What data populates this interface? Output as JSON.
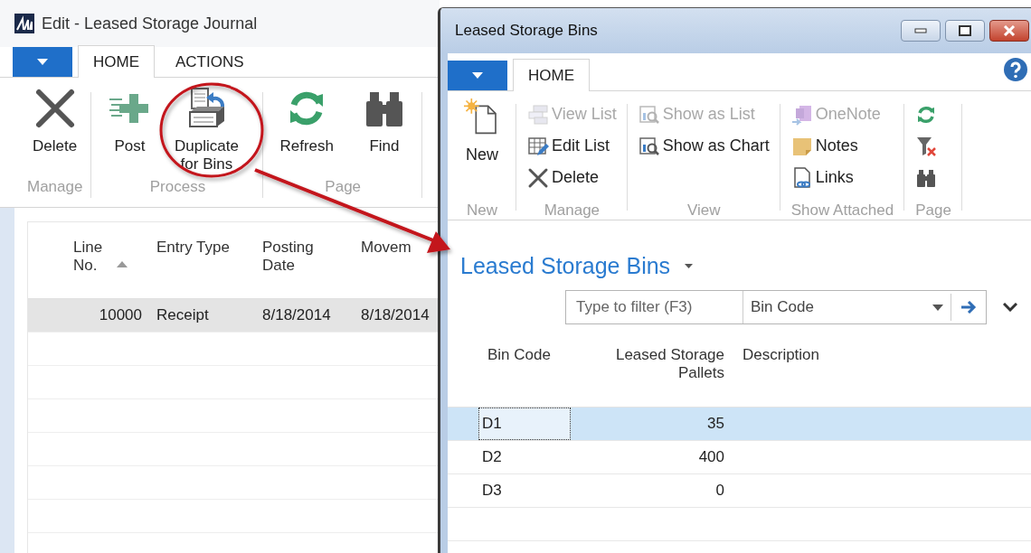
{
  "journal_window": {
    "title": "Edit - Leased Storage Journal",
    "tabs": [
      {
        "label": "HOME",
        "selected": true
      },
      {
        "label": "ACTIONS",
        "selected": false
      }
    ],
    "ribbon_groups": [
      {
        "label": "Manage",
        "actions": [
          {
            "kind": "delete",
            "label": "Delete"
          }
        ]
      },
      {
        "label": "Process",
        "actions": [
          {
            "kind": "post",
            "label": "Post"
          },
          {
            "kind": "duplicate",
            "label": "Duplicate for Bins"
          }
        ]
      },
      {
        "label": "Page",
        "actions": [
          {
            "kind": "refresh",
            "label": "Refresh"
          },
          {
            "kind": "find",
            "label": "Find"
          }
        ]
      }
    ],
    "table": {
      "columns": [
        {
          "label": "Line No.",
          "kind": "number",
          "sorted": true
        },
        {
          "label": "Entry Type",
          "kind": "text",
          "sorted": false
        },
        {
          "label": "Posting Date",
          "kind": "text",
          "sorted": false
        },
        {
          "label": "Movem",
          "kind": "text",
          "sorted": false
        }
      ],
      "rows": [
        {
          "cells": [
            "10000",
            "Receipt",
            "8/18/2014",
            "8/18/2014"
          ],
          "selected": true
        }
      ]
    }
  },
  "bins_window": {
    "title": "Leased Storage Bins",
    "tabs": [
      {
        "label": "HOME",
        "selected": true
      }
    ],
    "ribbon_groups": [
      {
        "label": "New",
        "kind": "large",
        "actions": [
          {
            "kind": "new",
            "label": "New",
            "disabled": false
          }
        ]
      },
      {
        "label": "Manage",
        "kind": "small",
        "actions": [
          {
            "kind": "view-list",
            "label": "View List",
            "disabled": true
          },
          {
            "kind": "edit-list",
            "label": "Edit List",
            "disabled": false
          },
          {
            "kind": "delete",
            "label": "Delete",
            "disabled": false
          }
        ]
      },
      {
        "label": "View",
        "kind": "small",
        "actions": [
          {
            "kind": "show-list",
            "label": "Show as List",
            "disabled": true
          },
          {
            "kind": "show-chart",
            "label": "Show as Chart",
            "disabled": false
          }
        ]
      },
      {
        "label": "Show Attached",
        "kind": "small",
        "actions": [
          {
            "kind": "onenote",
            "label": "OneNote",
            "disabled": true
          },
          {
            "kind": "notes",
            "label": "Notes",
            "disabled": false
          },
          {
            "kind": "links",
            "label": "Links",
            "disabled": false
          }
        ]
      },
      {
        "label": "Page",
        "kind": "small",
        "actions": [
          {
            "kind": "refresh",
            "disabled": false
          },
          {
            "kind": "clear-filter",
            "disabled": false
          },
          {
            "kind": "find",
            "disabled": false
          }
        ]
      }
    ],
    "page_title": "Leased Storage Bins",
    "filter": {
      "placeholder": "Type to filter (F3)",
      "field": "Bin Code"
    },
    "table": {
      "columns": [
        {
          "label": "Bin Code",
          "kind": "text"
        },
        {
          "label": "Leased Storage Pallets",
          "kind": "number"
        },
        {
          "label": "Description",
          "kind": "text"
        }
      ],
      "rows": [
        {
          "cells": [
            "D1",
            "35"
          ],
          "selected": true
        },
        {
          "cells": [
            "D2",
            "400"
          ],
          "selected": false
        },
        {
          "cells": [
            "D3",
            "0"
          ],
          "selected": false
        }
      ]
    }
  }
}
